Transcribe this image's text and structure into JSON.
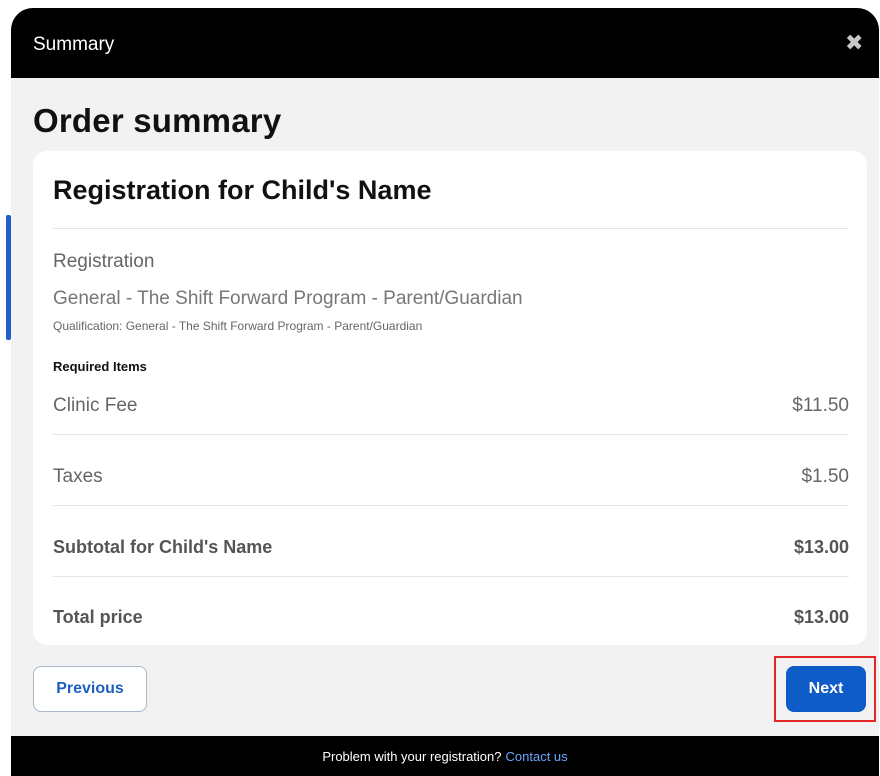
{
  "window": {
    "title": "Summary",
    "close_icon": "close-icon"
  },
  "page": {
    "title": "Order summary"
  },
  "card": {
    "heading": "Registration for Child's Name",
    "registration_label": "Registration",
    "program_name": "General - The Shift Forward Program - Parent/Guardian",
    "qualification": "Qualification: General - The Shift Forward Program - Parent/Guardian",
    "required_items_label": "Required Items",
    "rows": [
      {
        "label": "Clinic Fee",
        "amount": "$11.50"
      },
      {
        "label": "Taxes",
        "amount": "$1.50"
      },
      {
        "label": "Subtotal for Child's Name",
        "amount": "$13.00"
      },
      {
        "label": "Total price",
        "amount": "$13.00"
      }
    ]
  },
  "buttons": {
    "previous": "Previous",
    "next": "Next"
  },
  "footer": {
    "text": "Problem with your registration?",
    "link": "Contact us"
  },
  "colors": {
    "primary": "#0f5bc7",
    "header_bg": "#000000",
    "highlight": "#e12727"
  }
}
